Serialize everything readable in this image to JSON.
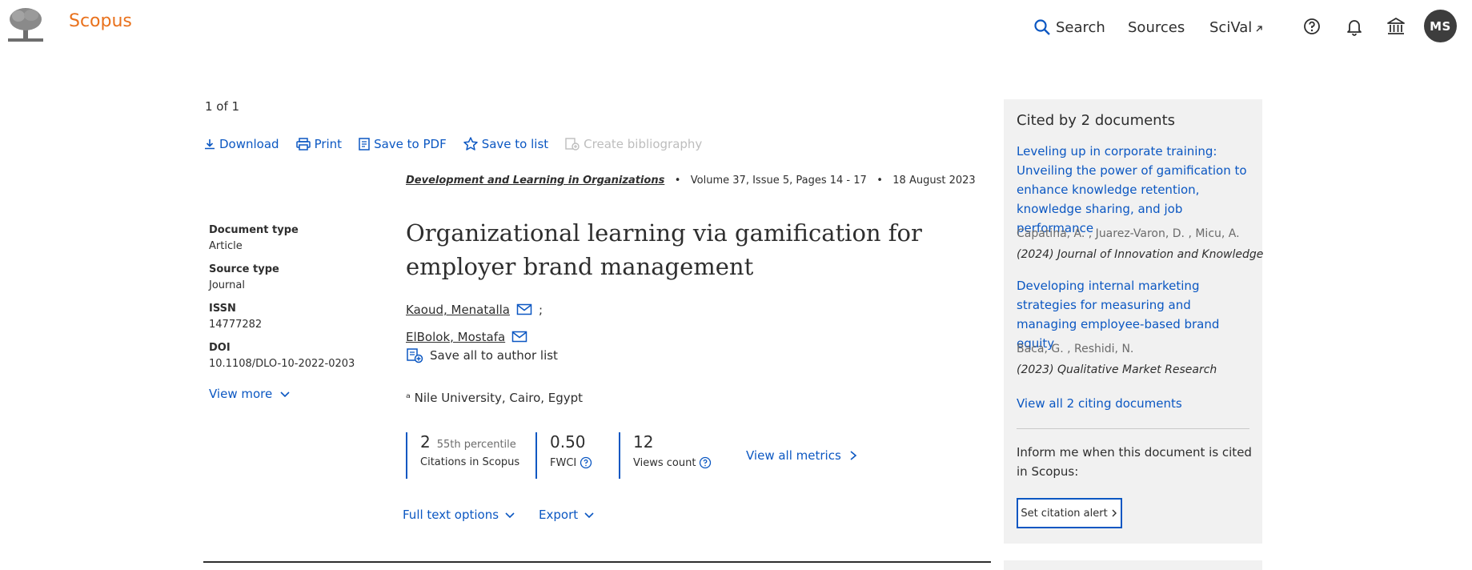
{
  "header": {
    "brand": "Scopus",
    "nav": {
      "search": "Search",
      "sources": "Sources",
      "scival": "SciVal"
    },
    "avatar": "MS"
  },
  "results": {
    "count": "1 of 1"
  },
  "toolbar": {
    "download": "Download",
    "print": "Print",
    "save_pdf": "Save to PDF",
    "save_list": "Save to list",
    "bibliography": "Create bibliography"
  },
  "source": {
    "journal": "Development and Learning in Organizations",
    "volume": "Volume 37, Issue 5, Pages 14 - 17",
    "date": "18 August 2023"
  },
  "article": {
    "title": "Organizational learning via gamification for employer brand management"
  },
  "authors": [
    {
      "name": "Kaoud, Menatalla",
      "sep": ";"
    },
    {
      "name": "ElBolok, Mostafa",
      "sep": ""
    }
  ],
  "save_authors": "Save all to author list",
  "affiliation": "ᵃ Nile University, Cairo, Egypt",
  "meta": {
    "doc_type_label": "Document type",
    "doc_type": "Article",
    "source_type_label": "Source type",
    "source_type": "Journal",
    "issn_label": "ISSN",
    "issn": "14777282",
    "doi_label": "DOI",
    "doi": "10.1108/DLO-10-2022-0203",
    "view_more": "View more"
  },
  "metrics": {
    "citations": "2",
    "percentile": "55th percentile",
    "citations_label": "Citations in Scopus",
    "fwci": "0.50",
    "fwci_label": "FWCI",
    "views": "12",
    "views_label": "Views count",
    "all": "View all metrics"
  },
  "actions": {
    "full_text": "Full text options",
    "export": "Export"
  },
  "cited_by": {
    "title": "Cited by 2 documents",
    "docs": [
      {
        "title": "Leveling up in corporate training: Unveiling the power of gamification to enhance knowledge retention, knowledge sharing, and job performance",
        "authors": "Capatina, A. , Juarez-Varon, D. , Micu, A.",
        "journal": "(2024) Journal of Innovation and Knowledge"
      },
      {
        "title": "Developing internal marketing strategies for measuring and managing employee-based brand equity",
        "authors": "Baca, G. , Reshidi, N.",
        "journal": "(2023) Qualitative Market Research"
      }
    ],
    "view_all": "View all 2 citing documents",
    "inform": "Inform me when this document is cited in Scopus:",
    "alert": "Set citation alert"
  },
  "colors": {
    "brand": "#e9711c",
    "link": "#0b57c2",
    "panel": "#f1f1f1"
  }
}
